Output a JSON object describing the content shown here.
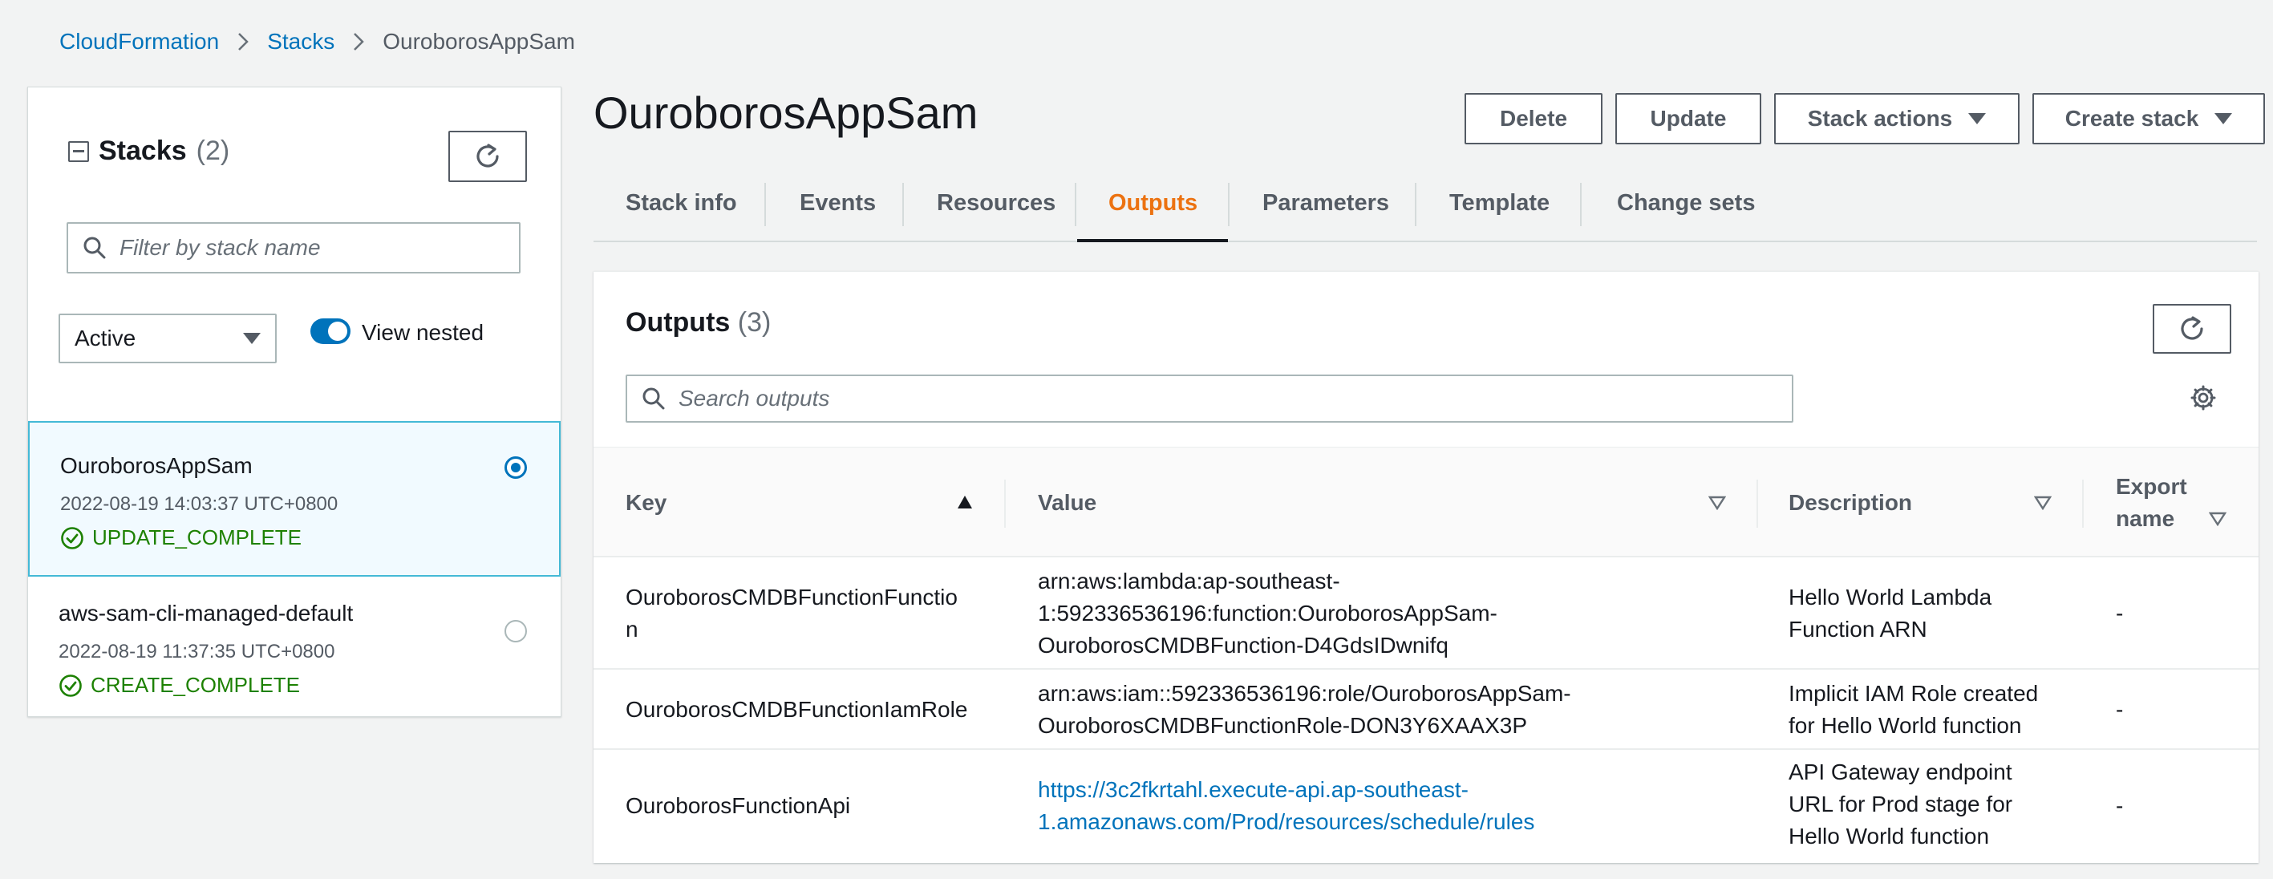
{
  "breadcrumb": {
    "root": "CloudFormation",
    "stacks": "Stacks",
    "current": "OuroborosAppSam"
  },
  "sidebar": {
    "title": "Stacks",
    "count": "(2)",
    "search_placeholder": "Filter by stack name",
    "filter_selected": "Active",
    "toggle_label": "View nested",
    "page": "1",
    "stacks": [
      {
        "name": "OuroborosAppSam",
        "date": "2022-08-19 14:03:37 UTC+0800",
        "status": "UPDATE_COMPLETE",
        "selected": true
      },
      {
        "name": "aws-sam-cli-managed-default",
        "date": "2022-08-19 11:37:35 UTC+0800",
        "status": "CREATE_COMPLETE",
        "selected": false
      }
    ]
  },
  "main": {
    "title": "OuroborosAppSam",
    "buttons": {
      "delete": "Delete",
      "update": "Update",
      "stack_actions": "Stack actions",
      "create_stack": "Create stack"
    },
    "tabs": [
      "Stack info",
      "Events",
      "Resources",
      "Outputs",
      "Parameters",
      "Template",
      "Change sets"
    ],
    "active_tab": "Outputs"
  },
  "outputs": {
    "title": "Outputs",
    "count": "(3)",
    "search_placeholder": "Search outputs",
    "columns": {
      "key": "Key",
      "value": "Value",
      "description": "Description",
      "export_line1": "Export",
      "export_line2": "name"
    },
    "rows": [
      {
        "key_line1": "OuroborosCMDBFunctionFunctio",
        "key_line2": "n",
        "value_line1": "arn:aws:lambda:ap-southeast-",
        "value_line2": "1:592336536196:function:OuroborosAppSam-",
        "value_line3": "OuroborosCMDBFunction-D4GdsIDwnifq",
        "desc_line1": "Hello World Lambda",
        "desc_line2": "Function ARN",
        "export": "-"
      },
      {
        "key_line1": "OuroborosCMDBFunctionIamRole",
        "value_line1": "arn:aws:iam::592336536196:role/OuroborosAppSam-",
        "value_line2": "OuroborosCMDBFunctionRole-DON3Y6XAAX3P",
        "desc_line1": "Implicit IAM Role created",
        "desc_line2": "for Hello World function",
        "export": "-"
      },
      {
        "key_line1": "OuroborosFunctionApi",
        "value_line1": "https://3c2fkrtahl.execute-api.ap-southeast-",
        "value_line2": "1.amazonaws.com/Prod/resources/schedule/rules",
        "desc_line1": "API Gateway endpoint",
        "desc_line2": "URL for Prod stage for",
        "desc_line3": "Hello World function",
        "export": "-"
      }
    ]
  },
  "colors": {
    "link": "#0073bb",
    "active_tab": "#ec7211",
    "success": "#1d8102",
    "selected_border": "#44b9d6"
  }
}
